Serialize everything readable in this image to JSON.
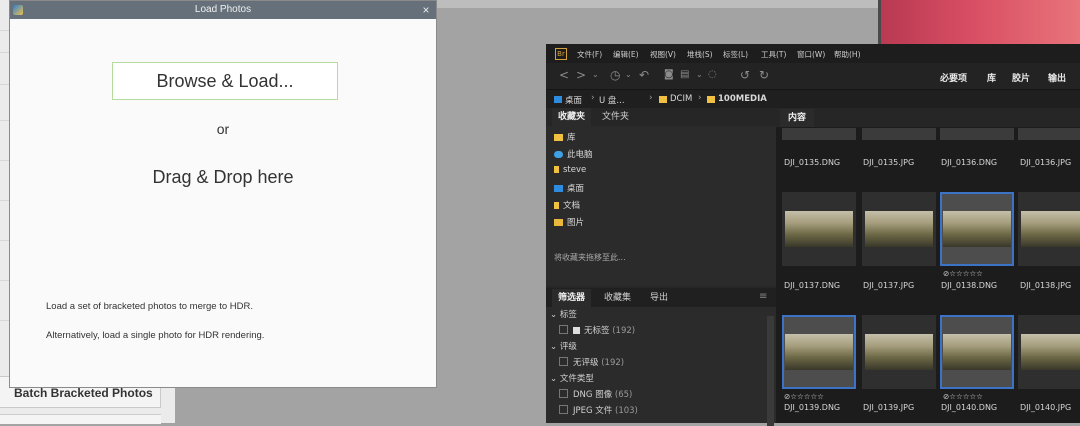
{
  "background_app": {
    "button_label": "Batch Bracketed Photos"
  },
  "dialog": {
    "title": "Load Photos",
    "close": "×",
    "browse_button": "Browse & Load...",
    "or": "or",
    "drag_drop": "Drag & Drop here",
    "hint_line1": "Load a set of bracketed photos to merge to HDR.",
    "hint_line2": "Alternatively, load a single photo for HDR rendering."
  },
  "bridge": {
    "logo": "Br",
    "menu": [
      "文件(F)",
      "编辑(E)",
      "视图(V)",
      "堆栈(S)",
      "标签(L)",
      "工具(T)",
      "窗口(W)",
      "帮助(H)"
    ],
    "workspaces": [
      "必要项",
      "库",
      "胶片",
      "输出"
    ],
    "breadcrumb": [
      "桌面",
      "U 盘...",
      "DCIM",
      "100MEDIA"
    ],
    "left_tabs": [
      "收藏夹",
      "文件夹"
    ],
    "favorites": [
      "库",
      "此电脑",
      "steve",
      "桌面",
      "文档",
      "图片"
    ],
    "favorites_hint": "将收藏夹拖移至此...",
    "filter_tabs": [
      "筛选器",
      "收藏集",
      "导出"
    ],
    "filters": {
      "label_header": "标签",
      "no_label": "无标签",
      "no_label_count": "(192)",
      "rating_header": "评级",
      "no_rating": "无评级",
      "no_rating_count": "(192)",
      "filetype_header": "文件类型",
      "dng": "DNG 图像",
      "dng_count": "(65)",
      "jpeg": "JPEG 文件",
      "jpeg_count": "(103)"
    },
    "content_tab": "内容",
    "row0": [
      "DJI_0135.DNG",
      "DJI_0135.JPG",
      "DJI_0136.DNG",
      "DJI_0136.JPG"
    ],
    "row1": [
      "DJI_0137.DNG",
      "DJI_0137.JPG",
      "DJI_0138.DNG",
      "DJI_0138.JPG"
    ],
    "row2": [
      "DJI_0139.DNG",
      "DJI_0139.JPG",
      "DJI_0140.DNG",
      "DJI_0140.JPG"
    ],
    "stars": "⊘☆☆☆☆☆"
  }
}
